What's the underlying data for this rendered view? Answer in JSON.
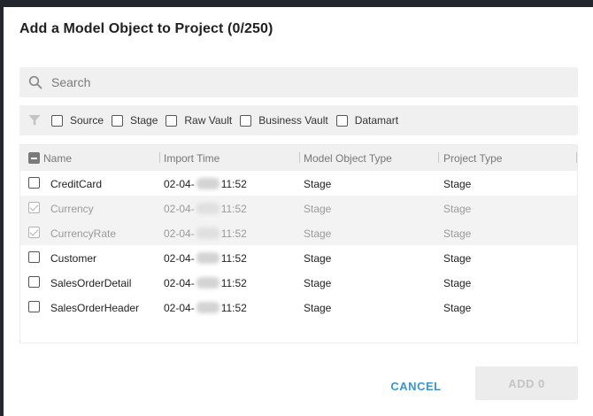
{
  "dialog": {
    "title": "Add a Model Object to Project (0/250)"
  },
  "search": {
    "placeholder": "Search"
  },
  "filters": [
    {
      "label": "Source",
      "checked": false
    },
    {
      "label": "Stage",
      "checked": false
    },
    {
      "label": "Raw Vault",
      "checked": false
    },
    {
      "label": "Business Vault",
      "checked": false
    },
    {
      "label": "Datamart",
      "checked": false
    }
  ],
  "table": {
    "columns": {
      "name": "Name",
      "import_time": "Import Time",
      "model_object_type": "Model Object Type",
      "project_type": "Project Type"
    },
    "rows": [
      {
        "name": "CreditCard",
        "date_prefix": "02-04-",
        "time": "11:52",
        "model_object_type": "Stage",
        "project_type": "Stage",
        "checked": false,
        "disabled": false
      },
      {
        "name": "Currency",
        "date_prefix": "02-04-",
        "time": "11:52",
        "model_object_type": "Stage",
        "project_type": "Stage",
        "checked": true,
        "disabled": true
      },
      {
        "name": "CurrencyRate",
        "date_prefix": "02-04-",
        "time": "11:52",
        "model_object_type": "Stage",
        "project_type": "Stage",
        "checked": true,
        "disabled": true
      },
      {
        "name": "Customer",
        "date_prefix": "02-04-",
        "time": "11:52",
        "model_object_type": "Stage",
        "project_type": "Stage",
        "checked": false,
        "disabled": false
      },
      {
        "name": "SalesOrderDetail",
        "date_prefix": "02-04-",
        "time": "11:52",
        "model_object_type": "Stage",
        "project_type": "Stage",
        "checked": false,
        "disabled": false
      },
      {
        "name": "SalesOrderHeader",
        "date_prefix": "02-04-",
        "time": "11:52",
        "model_object_type": "Stage",
        "project_type": "Stage",
        "checked": false,
        "disabled": false
      }
    ]
  },
  "actions": {
    "cancel_label": "CANCEL",
    "add_label": "ADD 0"
  },
  "colors": {
    "accent": "#3b97c9",
    "backdrop": "#23272d",
    "panel": "#f0f0f0"
  }
}
